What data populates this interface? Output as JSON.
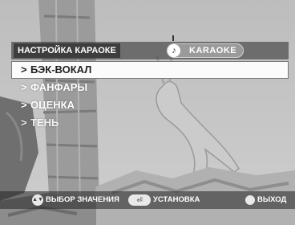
{
  "header": {
    "menu_title": "НАСТРОЙКА КАРАОКЕ",
    "mode_label": "KARAOKE",
    "mode_icon": "music-note-icon"
  },
  "menu": {
    "bullet": ">",
    "items": [
      {
        "label": "БЭК-ВОКАЛ",
        "selected": true
      },
      {
        "label": "ФАНФАРЫ",
        "selected": false
      },
      {
        "label": "ОЦЕНКА",
        "selected": false
      },
      {
        "label": "ТЕНЬ",
        "selected": false
      }
    ]
  },
  "footer": {
    "select_value_label": "ВЫБОР ЗНАЧЕНИЯ",
    "install_label": "УСТАНОВКА",
    "exit_label": "ВЫХОД"
  },
  "colors": {
    "selection_bg": "#fbfbfb",
    "title_bg": "#3d3d3d",
    "badge_bg": "#9a9a9a"
  }
}
